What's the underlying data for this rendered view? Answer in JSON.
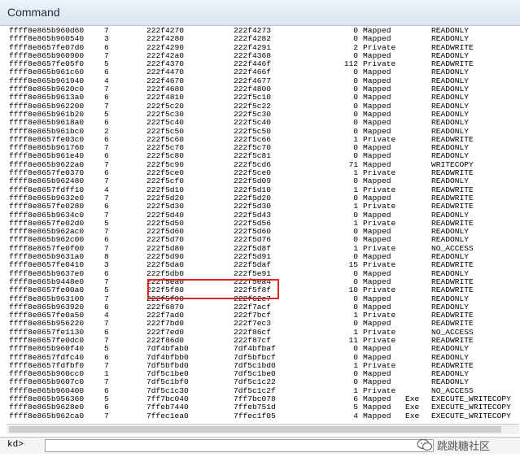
{
  "window": {
    "title": "Command"
  },
  "command": {
    "prompt": "kd>",
    "value": ""
  },
  "watermark": {
    "text": "跳跳糖社区",
    "icon": "wechat-icon"
  },
  "rows": [
    [
      "ffff8e865b960d60",
      "7",
      "222f4270",
      "222f4273",
      "0",
      "Mapped",
      "",
      "READONLY"
    ],
    [
      "ffff8e865b960540",
      "3",
      "222f4280",
      "222f4282",
      "0",
      "Mapped",
      "",
      "READONLY"
    ],
    [
      "ffff8e8657fe07d0",
      "6",
      "222f4290",
      "222f4291",
      "2",
      "Private",
      "",
      "READWRITE"
    ],
    [
      "ffff8e865b960900",
      "7",
      "222f42a0",
      "222f4368",
      "0",
      "Mapped",
      "",
      "READONLY"
    ],
    [
      "ffff8e8657fe05f0",
      "5",
      "222f4370",
      "222f446f",
      "112",
      "Private",
      "",
      "READWRITE"
    ],
    [
      "ffff8e865b961c60",
      "6",
      "222f4470",
      "222f466f",
      "0",
      "Mapped",
      "",
      "READONLY"
    ],
    [
      "ffff8e865b961940",
      "4",
      "222f4670",
      "222f4677",
      "0",
      "Mapped",
      "",
      "READONLY"
    ],
    [
      "ffff8e865b9620c0",
      "7",
      "222f4680",
      "222f4800",
      "0",
      "Mapped",
      "",
      "READONLY"
    ],
    [
      "ffff8e865b9613a0",
      "6",
      "222f4810",
      "222f5c10",
      "0",
      "Mapped",
      "",
      "READONLY"
    ],
    [
      "ffff8e865b962200",
      "7",
      "222f5c20",
      "222f5c22",
      "0",
      "Mapped",
      "",
      "READONLY"
    ],
    [
      "ffff8e865b961b20",
      "5",
      "222f5c30",
      "222f5c30",
      "0",
      "Mapped",
      "",
      "READONLY"
    ],
    [
      "ffff8e865b9618a0",
      "6",
      "222f5c40",
      "222f5c40",
      "0",
      "Mapped",
      "",
      "READONLY"
    ],
    [
      "ffff8e865b961bc0",
      "2",
      "222f5c50",
      "222f5c50",
      "0",
      "Mapped",
      "",
      "READONLY"
    ],
    [
      "ffff8e8657fe03c0",
      "6",
      "222f5c60",
      "222f5c66",
      "1",
      "Private",
      "",
      "READWRITE"
    ],
    [
      "ffff8e865b961760",
      "7",
      "222f5c70",
      "222f5c70",
      "0",
      "Mapped",
      "",
      "READONLY"
    ],
    [
      "ffff8e865b961e40",
      "6",
      "222f5c80",
      "222f5c81",
      "0",
      "Mapped",
      "",
      "READONLY"
    ],
    [
      "ffff8e865b9622a0",
      "7",
      "222f5c90",
      "222f5cd6",
      "71",
      "Mapped",
      "",
      "WRITECOPY"
    ],
    [
      "ffff8e8657fe0370",
      "6",
      "222f5ce0",
      "222f5ce0",
      "1",
      "Private",
      "",
      "READWRITE"
    ],
    [
      "ffff8e865b962480",
      "7",
      "222f5cf0",
      "222f5d09",
      "0",
      "Mapped",
      "",
      "READONLY"
    ],
    [
      "ffff8e8657fdff10",
      "4",
      "222f5d10",
      "222f5d10",
      "1",
      "Private",
      "",
      "READWRITE"
    ],
    [
      "ffff8e865b9632e0",
      "7",
      "222f5d20",
      "222f5d20",
      "0",
      "Mapped",
      "",
      "READWRITE"
    ],
    [
      "ffff8e8657fe0280",
      "6",
      "222f5d30",
      "222f5d30",
      "1",
      "Private",
      "",
      "READWRITE"
    ],
    [
      "ffff8e865b9634c0",
      "7",
      "222f5d40",
      "222f5d43",
      "0",
      "Mapped",
      "",
      "READONLY"
    ],
    [
      "ffff8e8657fe02d0",
      "5",
      "222f5d50",
      "222f5d56",
      "1",
      "Private",
      "",
      "READWRITE"
    ],
    [
      "ffff8e865b962ac0",
      "7",
      "222f5d60",
      "222f5d60",
      "0",
      "Mapped",
      "",
      "READONLY"
    ],
    [
      "ffff8e865b962c00",
      "6",
      "222f5d70",
      "222f5d76",
      "0",
      "Mapped",
      "",
      "READONLY"
    ],
    [
      "ffff8e8657fe0f00",
      "7",
      "222f5d80",
      "222f5d8f",
      "1",
      "Private",
      "",
      "NO_ACCESS"
    ],
    [
      "ffff8e865b9631a0",
      "8",
      "222f5d90",
      "222f5d91",
      "0",
      "Mapped",
      "",
      "READONLY"
    ],
    [
      "ffff8e8657fe0410",
      "3",
      "222f5da0",
      "222f5daf",
      "15",
      "Private",
      "",
      "READWRITE"
    ],
    [
      "ffff8e865b9637e0",
      "6",
      "222f5db0",
      "222f5e91",
      "0",
      "Mapped",
      "",
      "READONLY"
    ],
    [
      "ffff8e865b9448e0",
      "7",
      "222f5ea0",
      "222f5ea4",
      "0",
      "Mapped",
      "",
      "READWRITE"
    ],
    [
      "ffff8e8657fe00a0",
      "5",
      "222f5f80",
      "222f5f8f",
      "10",
      "Private",
      "",
      "READWRITE"
    ],
    [
      "ffff8e865b963100",
      "7",
      "222f5f90",
      "222f62c7",
      "0",
      "Mapped",
      "",
      "READONLY"
    ],
    [
      "ffff8e865b963920",
      "6",
      "222f6870",
      "222f7acf",
      "0",
      "Mapped",
      "",
      "READONLY"
    ],
    [
      "ffff8e8657fe0a50",
      "4",
      "222f7ad0",
      "222f7bcf",
      "1",
      "Private",
      "",
      "READWRITE"
    ],
    [
      "ffff8e865b956220",
      "7",
      "222f7bd0",
      "222f7ec3",
      "0",
      "Mapped",
      "",
      "READWRITE"
    ],
    [
      "ffff8e8657fe1130",
      "6",
      "222f7ed0",
      "222f86cf",
      "1",
      "Private",
      "",
      "NO_ACCESS"
    ],
    [
      "ffff8e8657fe0dc0",
      "7",
      "222f86d0",
      "222f87cf",
      "11",
      "Private",
      "",
      "READWRITE"
    ],
    [
      "ffff8e865b960f40",
      "5",
      "7df4bfab0",
      "7df4bfbaf",
      "0",
      "Mapped",
      "",
      "READONLY"
    ],
    [
      "ffff8e8657fdfc40",
      "6",
      "7df4bfbb0",
      "7df5bfbcf",
      "0",
      "Mapped",
      "",
      "READONLY"
    ],
    [
      "ffff8e8657fdfbf0",
      "7",
      "7df5bfbd0",
      "7df5c1bd0",
      "1",
      "Private",
      "",
      "READWRITE"
    ],
    [
      "ffff8e865b960cc0",
      "1",
      "7df5c1be0",
      "7df5c1be0",
      "0",
      "Mapped",
      "",
      "READONLY"
    ],
    [
      "ffff8e865b9607c0",
      "7",
      "7df5c1bf0",
      "7df5c1c22",
      "0",
      "Mapped",
      "",
      "READONLY"
    ],
    [
      "ffff8e865b960400",
      "6",
      "7df5c1c30",
      "7df5c1c2f",
      "1",
      "Private",
      "",
      "NO_ACCESS"
    ],
    [
      "ffff8e865b956360",
      "5",
      "7ff7bc040",
      "7ff7bc078",
      "6",
      "Mapped",
      "Exe",
      "EXECUTE_WRITECOPY"
    ],
    [
      "ffff8e865b9628e0",
      "6",
      "7ffeb7440",
      "7ffeb751d",
      "5",
      "Mapped",
      "Exe",
      "EXECUTE_WRITECOPY"
    ],
    [
      "ffff8e865b962ca0",
      "7",
      "7ffec1ea0",
      "7ffec1f05",
      "4",
      "Mapped",
      "Exe",
      "EXECUTE_WRITECOPY"
    ]
  ]
}
